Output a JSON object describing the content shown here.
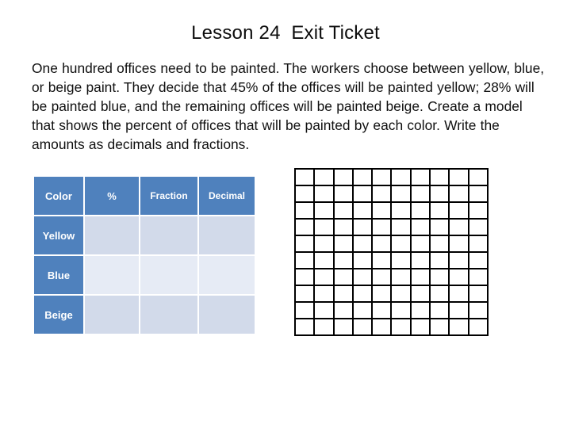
{
  "slide": {
    "title": "Lesson 24  Exit Ticket",
    "problem_text": "One hundred offices need to be painted.  The workers choose between yellow, blue, or beige paint.  They decide that 45% of the offices will be painted yellow; 28% will be painted blue, and the remaining offices will be painted beige.  Create a model that shows the percent of offices that will be painted by each color.  Write the amounts as decimals and fractions."
  },
  "table": {
    "headers": [
      "Color",
      "%",
      "Fraction",
      "Decimal"
    ],
    "rows": [
      {
        "label": "Yellow",
        "percent": "",
        "fraction": "",
        "decimal": ""
      },
      {
        "label": "Blue",
        "percent": "",
        "fraction": "",
        "decimal": ""
      },
      {
        "label": "Beige",
        "percent": "",
        "fraction": "",
        "decimal": ""
      }
    ],
    "header_fill": "#4f81bd",
    "header_text_color": "#ffffff",
    "cell_fill": "#d2daea",
    "cell_fill_alt": "#e6ebf5"
  },
  "grid": {
    "name": "hundreds-grid",
    "columns": 10,
    "rows": 10,
    "total_cells": 100,
    "shaded_cells": 0,
    "border_color": "#000000",
    "cell_fill": "#ffffff"
  },
  "values_referenced": {
    "total_offices": 100,
    "yellow_percent": 45,
    "blue_percent": 28
  }
}
